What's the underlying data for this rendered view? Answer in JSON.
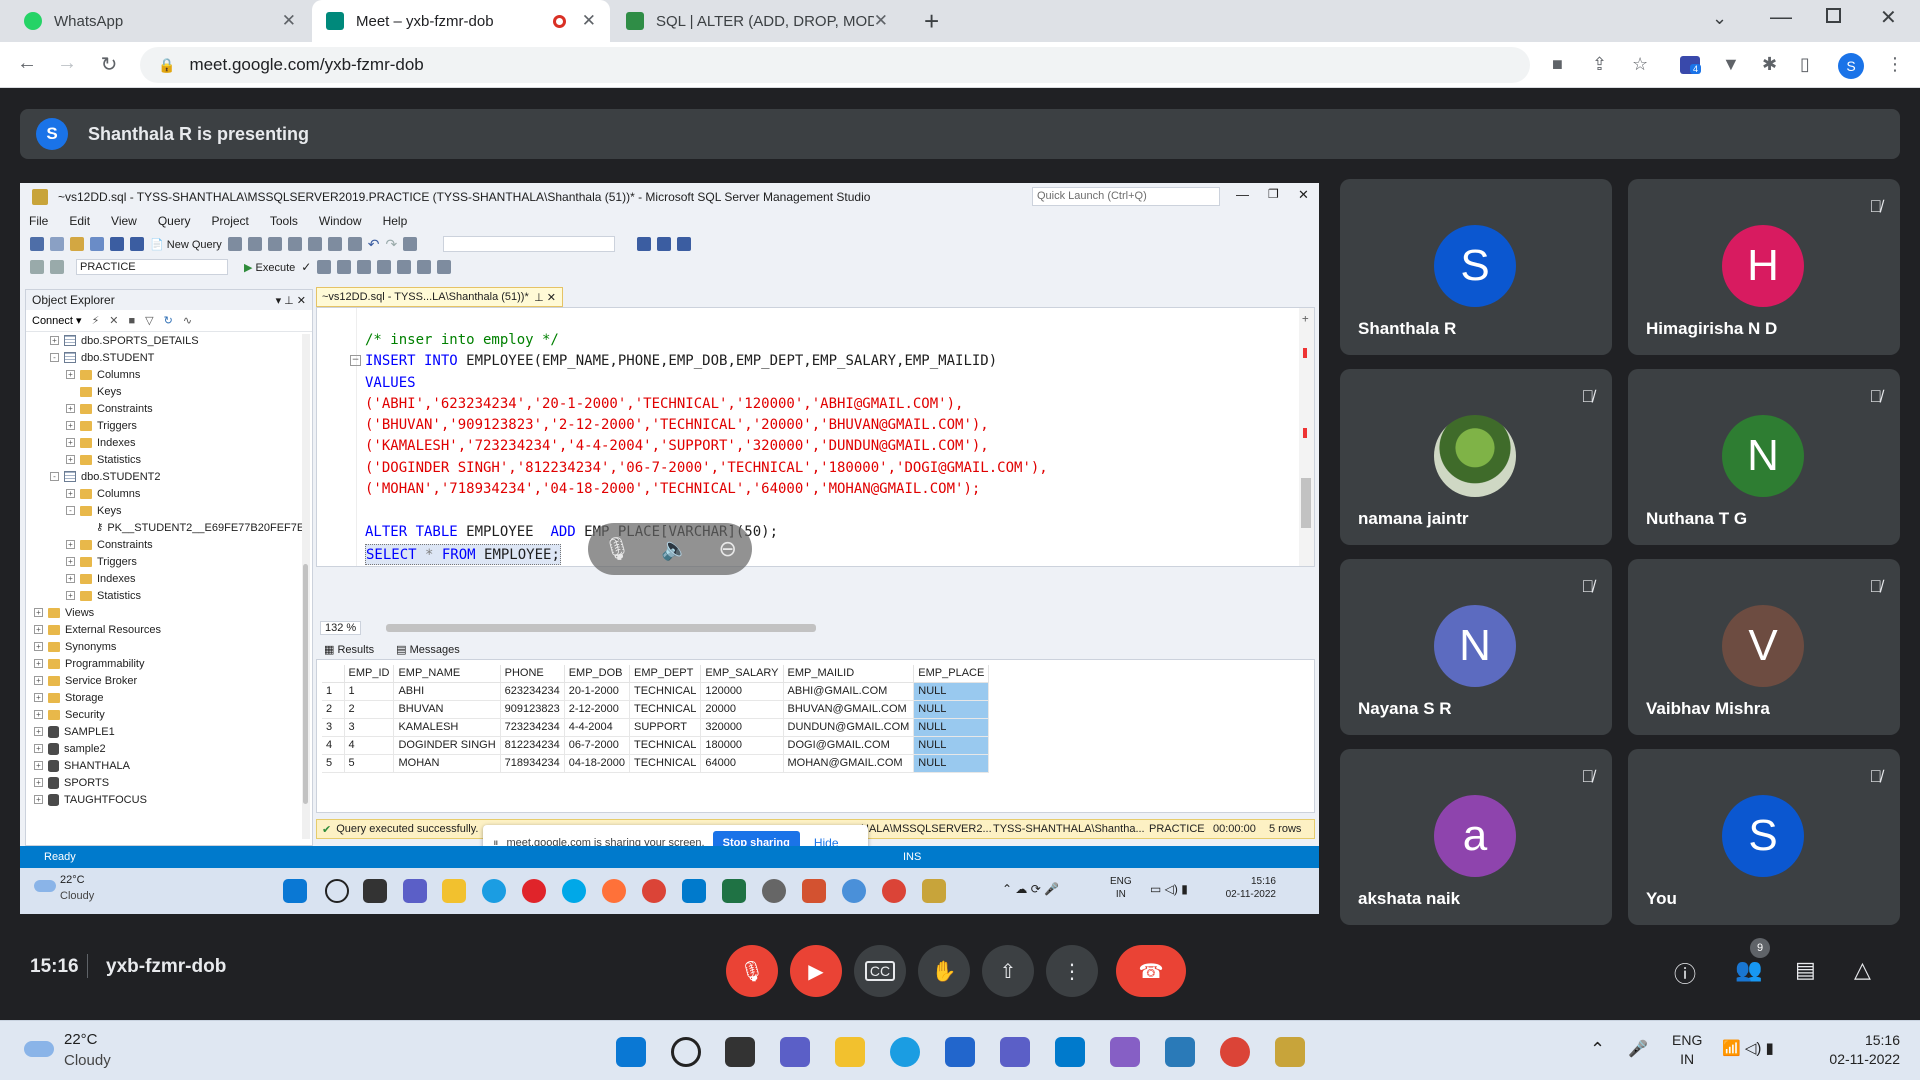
{
  "browser": {
    "tabs": [
      {
        "title": "WhatsApp",
        "color": "#25d366"
      },
      {
        "title": "Meet – yxb-fzmr-dob",
        "color": "#00897b"
      },
      {
        "title": "SQL | ALTER (ADD, DROP, MODIF",
        "color": "#2f8d46"
      }
    ],
    "url": "meet.google.com/yxb-fzmr-dob",
    "profile_initial": "S",
    "extension_badge": "4"
  },
  "presenting": {
    "initial": "S",
    "text": "Shanthala R is presenting"
  },
  "ssms": {
    "title": "~vs12DD.sql - TYSS-SHANTHALA\\MSSQLSERVER2019.PRACTICE (TYSS-SHANTHALA\\Shanthala (51))* - Microsoft SQL Server Management Studio",
    "quick_launch": "Quick Launch (Ctrl+Q)",
    "menu": [
      "File",
      "Edit",
      "View",
      "Query",
      "Project",
      "Tools",
      "Window",
      "Help"
    ],
    "new_query": "New Query",
    "db_select": "PRACTICE",
    "execute": "Execute",
    "object_explorer": {
      "title": "Object Explorer",
      "connect": "Connect",
      "tree": [
        {
          "label": "dbo.SPORTS_DETAILS",
          "level": 1,
          "icon": "table",
          "exp": "+"
        },
        {
          "label": "dbo.STUDENT",
          "level": 1,
          "icon": "table",
          "exp": "-"
        },
        {
          "label": "Columns",
          "level": 2,
          "icon": "folder",
          "exp": "+"
        },
        {
          "label": "Keys",
          "level": 2,
          "icon": "folder",
          "exp": ""
        },
        {
          "label": "Constraints",
          "level": 2,
          "icon": "folder",
          "exp": "+"
        },
        {
          "label": "Triggers",
          "level": 2,
          "icon": "folder",
          "exp": "+"
        },
        {
          "label": "Indexes",
          "level": 2,
          "icon": "folder",
          "exp": "+"
        },
        {
          "label": "Statistics",
          "level": 2,
          "icon": "folder",
          "exp": "+"
        },
        {
          "label": "dbo.STUDENT2",
          "level": 1,
          "icon": "table",
          "exp": "-"
        },
        {
          "label": "Columns",
          "level": 2,
          "icon": "folder",
          "exp": "+"
        },
        {
          "label": "Keys",
          "level": 2,
          "icon": "folder",
          "exp": "-"
        },
        {
          "label": "PK__STUDENT2__E69FE77B20FEF7E",
          "level": 3,
          "icon": "key",
          "exp": ""
        },
        {
          "label": "Constraints",
          "level": 2,
          "icon": "folder",
          "exp": "+"
        },
        {
          "label": "Triggers",
          "level": 2,
          "icon": "folder",
          "exp": "+"
        },
        {
          "label": "Indexes",
          "level": 2,
          "icon": "folder",
          "exp": "+"
        },
        {
          "label": "Statistics",
          "level": 2,
          "icon": "folder",
          "exp": "+"
        },
        {
          "label": "Views",
          "level": 0,
          "icon": "folder",
          "exp": "+"
        },
        {
          "label": "External Resources",
          "level": 0,
          "icon": "folder",
          "exp": "+"
        },
        {
          "label": "Synonyms",
          "level": 0,
          "icon": "folder",
          "exp": "+"
        },
        {
          "label": "Programmability",
          "level": 0,
          "icon": "folder",
          "exp": "+"
        },
        {
          "label": "Service Broker",
          "level": 0,
          "icon": "folder",
          "exp": "+"
        },
        {
          "label": "Storage",
          "level": 0,
          "icon": "folder",
          "exp": "+"
        },
        {
          "label": "Security",
          "level": 0,
          "icon": "folder",
          "exp": "+"
        },
        {
          "label": "SAMPLE1",
          "level": -1,
          "icon": "db",
          "exp": "+"
        },
        {
          "label": "sample2",
          "level": -1,
          "icon": "db",
          "exp": "+"
        },
        {
          "label": "SHANTHALA",
          "level": -1,
          "icon": "db",
          "exp": "+"
        },
        {
          "label": "SPORTS",
          "level": -1,
          "icon": "db",
          "exp": "+"
        },
        {
          "label": "TAUGHTFOCUS",
          "level": -1,
          "icon": "db",
          "exp": "+"
        }
      ]
    },
    "editor_tab": "~vs12DD.sql - TYSS...LA\\Shanthala (51))*",
    "code": {
      "comment": "/* inser into employ */",
      "insert_kw": "INSERT INTO",
      "insert_rest": " EMPLOYEE(EMP_NAME,PHONE,EMP_DOB,EMP_DEPT,EMP_SALARY,EMP_MAILID)",
      "values_kw": "VALUES",
      "rows": [
        "('ABHI','623234234','20-1-2000','TECHNICAL','120000','ABHI@GMAIL.COM'),",
        "('BHUVAN','909123823','2-12-2000','TECHNICAL','20000','BHUVAN@GMAIL.COM'),",
        "('KAMALESH','723234234','4-4-2004','SUPPORT','320000','DUNDUN@GMAIL.COM'),",
        "('DOGINDER SINGH','812234234','06-7-2000','TECHNICAL','180000','DOGI@GMAIL.COM'),",
        "('MOHAN','718934234','04-18-2000','TECHNICAL','64000','MOHAN@GMAIL.COM');"
      ],
      "alter_kw": "ALTER TABLE",
      "alter_tbl": " EMPLOYEE  ",
      "alter_add": "ADD",
      "alter_col": " EMP_PLACE[VARCHAR](50);",
      "select_kw1": "SELECT",
      "select_mid": " * ",
      "select_kw2": "FROM",
      "select_rest": " EMPLOYEE;"
    },
    "zoom": "132 %",
    "results_tab": "Results",
    "messages_tab": "Messages",
    "grid": {
      "columns": [
        "",
        "EMP_ID",
        "EMP_NAME",
        "PHONE",
        "EMP_DOB",
        "EMP_DEPT",
        "EMP_SALARY",
        "EMP_MAILID",
        "EMP_PLACE"
      ],
      "rows": [
        [
          "1",
          "1",
          "ABHI",
          "623234234",
          "20-1-2000",
          "TECHNICAL",
          "120000",
          "ABHI@GMAIL.COM",
          "NULL"
        ],
        [
          "2",
          "2",
          "BHUVAN",
          "909123823",
          "2-12-2000",
          "TECHNICAL",
          "20000",
          "BHUVAN@GMAIL.COM",
          "NULL"
        ],
        [
          "3",
          "3",
          "KAMALESH",
          "723234234",
          "4-4-2004",
          "SUPPORT",
          "320000",
          "DUNDUN@GMAIL.COM",
          "NULL"
        ],
        [
          "4",
          "4",
          "DOGINDER SINGH",
          "812234234",
          "06-7-2000",
          "TECHNICAL",
          "180000",
          "DOGI@GMAIL.COM",
          "NULL"
        ],
        [
          "5",
          "5",
          "MOHAN",
          "718934234",
          "04-18-2000",
          "TECHNICAL",
          "64000",
          "MOHAN@GMAIL.COM",
          "NULL"
        ]
      ]
    },
    "query_status": "Query executed successfully.",
    "status_server": "HALA\\MSSQLSERVER2...",
    "status_user": "TYSS-SHANTHALA\\Shantha...",
    "status_db": "PRACTICE",
    "status_time": "00:00:00",
    "status_rows": "5 rows",
    "ready": "Ready",
    "ins": "INS",
    "share_text": "meet.google.com is sharing your screen.",
    "stop_sharing": "Stop sharing",
    "hide": "Hide",
    "inner_weather_temp": "22°C",
    "inner_weather_desc": "Cloudy",
    "inner_lang1": "ENG",
    "inner_lang2": "IN",
    "inner_time": "15:16",
    "inner_date": "02-11-2022"
  },
  "participants": [
    {
      "name": "Shanthala R",
      "initial": "S",
      "color": "#0b57d0",
      "muted": false
    },
    {
      "name": "Himagirisha N D",
      "initial": "H",
      "color": "#d81b60",
      "muted": true
    },
    {
      "name": "namana jaintr",
      "initial": "",
      "color": "#6d8b3d",
      "muted": true
    },
    {
      "name": "Nuthana T G",
      "initial": "N",
      "color": "#2e7d32",
      "muted": true
    },
    {
      "name": "Nayana S R",
      "initial": "N",
      "color": "#5c6bc0",
      "muted": true
    },
    {
      "name": "Vaibhav Mishra",
      "initial": "V",
      "color": "#6d4c41",
      "muted": true
    },
    {
      "name": "akshata naik",
      "initial": "a",
      "color": "#8e44ad",
      "muted": true
    },
    {
      "name": "You",
      "initial": "S",
      "color": "#0b57d0",
      "muted": true
    }
  ],
  "meeting": {
    "time": "15:16",
    "code": "yxb-fzmr-dob",
    "people_count": "9"
  },
  "taskbar": {
    "temp": "22°C",
    "desc": "Cloudy",
    "lang1": "ENG",
    "lang2": "IN",
    "time": "15:16",
    "date": "02-11-2022"
  }
}
